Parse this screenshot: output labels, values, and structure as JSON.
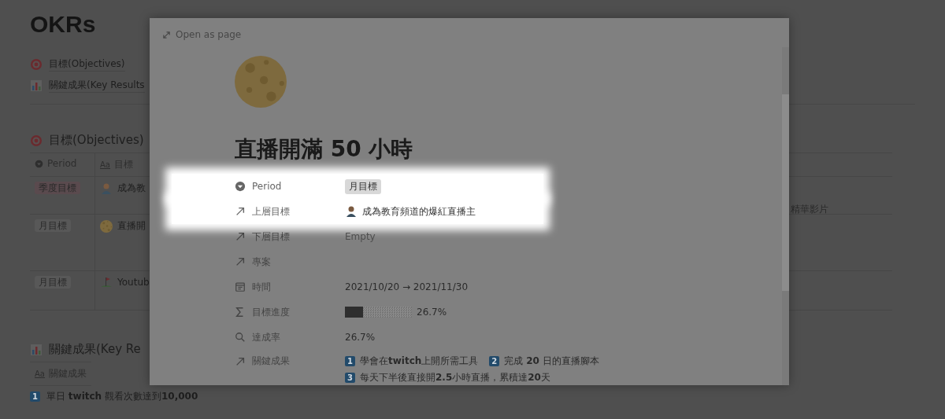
{
  "page": {
    "title": "OKRs",
    "links": [
      {
        "kind": "target",
        "label": "目標(Objectives)"
      },
      {
        "kind": "chart",
        "label": "關鍵成果(Key Results"
      }
    ],
    "objectives": {
      "heading": "目標(Objectives)",
      "columns": [
        "Period",
        "目標"
      ],
      "rows": [
        {
          "period": "季度目標",
          "color": "#5a4a4e",
          "kind": "person",
          "name": "成為教"
        },
        {
          "period": "月目標",
          "color": "#585858",
          "kind": "moon",
          "name": "直播開"
        },
        {
          "period": "月目標",
          "color": "#585858",
          "kind": "flag",
          "name": "Youtub"
        }
      ],
      "type_icon": "Aa",
      "side_cell": "精華影片"
    },
    "key_results": {
      "heading": "關鍵成果(Key Re",
      "column": "關鍵成果",
      "type_icon": "Aa",
      "rows": [
        {
          "badge": "1",
          "text": "單日 **twitch** 觀看次數達到**10,000**"
        }
      ]
    }
  },
  "modal": {
    "open_as_page": "Open as page",
    "title": "直播開滿 50 小時",
    "properties": [
      {
        "kind": "select",
        "label": "Period",
        "highlighted": true,
        "value": "月目標"
      },
      {
        "kind": "relation",
        "label": "上層目標",
        "highlighted": true,
        "value": "成為教育頻道的爆紅直播主"
      },
      {
        "kind": "empty",
        "label": "下層目標",
        "highlighted": false,
        "placeholder": "Empty"
      },
      {
        "kind": "blank",
        "label": "專案",
        "highlighted": false
      },
      {
        "kind": "date",
        "label": "時間",
        "highlighted": false,
        "value": "2021/10/20 → 2021/11/30"
      },
      {
        "kind": "progress",
        "label": "目標進度",
        "highlighted": false,
        "level": 0.267,
        "value": "26.7%"
      },
      {
        "kind": "text",
        "label": "達成率",
        "highlighted": false,
        "value": "26.7%"
      },
      {
        "kind": "list",
        "label": "關鍵成果",
        "highlighted": false,
        "items": [
          {
            "badge": "1",
            "text": "學會在**twitch**上開所需工具"
          },
          {
            "badge": "2",
            "text": "完成 **20** 日的直播腳本"
          },
          {
            "badge": "3",
            "text": "每天下半後直接開**2.5**小時直播，累積達**20**天"
          }
        ]
      }
    ]
  }
}
